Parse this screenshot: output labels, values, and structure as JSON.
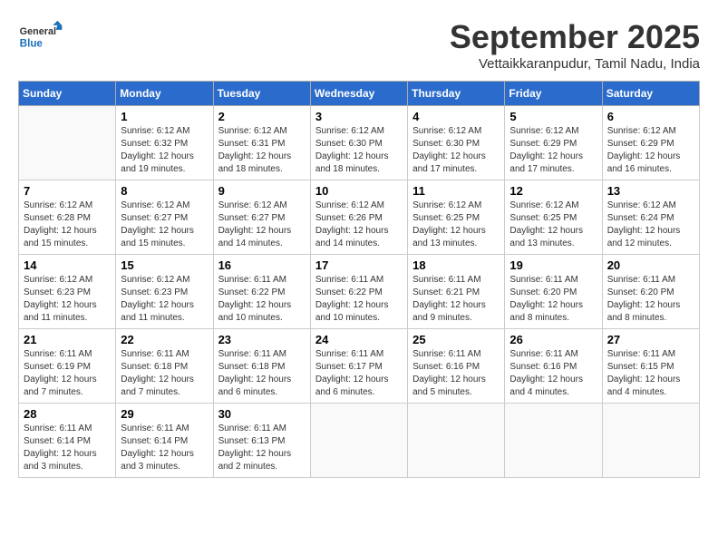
{
  "header": {
    "logo_general": "General",
    "logo_blue": "Blue",
    "month": "September 2025",
    "location": "Vettaikkaranpudur, Tamil Nadu, India"
  },
  "weekdays": [
    "Sunday",
    "Monday",
    "Tuesday",
    "Wednesday",
    "Thursday",
    "Friday",
    "Saturday"
  ],
  "weeks": [
    [
      {
        "day": "",
        "info": ""
      },
      {
        "day": "1",
        "info": "Sunrise: 6:12 AM\nSunset: 6:32 PM\nDaylight: 12 hours\nand 19 minutes."
      },
      {
        "day": "2",
        "info": "Sunrise: 6:12 AM\nSunset: 6:31 PM\nDaylight: 12 hours\nand 18 minutes."
      },
      {
        "day": "3",
        "info": "Sunrise: 6:12 AM\nSunset: 6:30 PM\nDaylight: 12 hours\nand 18 minutes."
      },
      {
        "day": "4",
        "info": "Sunrise: 6:12 AM\nSunset: 6:30 PM\nDaylight: 12 hours\nand 17 minutes."
      },
      {
        "day": "5",
        "info": "Sunrise: 6:12 AM\nSunset: 6:29 PM\nDaylight: 12 hours\nand 17 minutes."
      },
      {
        "day": "6",
        "info": "Sunrise: 6:12 AM\nSunset: 6:29 PM\nDaylight: 12 hours\nand 16 minutes."
      }
    ],
    [
      {
        "day": "7",
        "info": "Sunrise: 6:12 AM\nSunset: 6:28 PM\nDaylight: 12 hours\nand 15 minutes."
      },
      {
        "day": "8",
        "info": "Sunrise: 6:12 AM\nSunset: 6:27 PM\nDaylight: 12 hours\nand 15 minutes."
      },
      {
        "day": "9",
        "info": "Sunrise: 6:12 AM\nSunset: 6:27 PM\nDaylight: 12 hours\nand 14 minutes."
      },
      {
        "day": "10",
        "info": "Sunrise: 6:12 AM\nSunset: 6:26 PM\nDaylight: 12 hours\nand 14 minutes."
      },
      {
        "day": "11",
        "info": "Sunrise: 6:12 AM\nSunset: 6:25 PM\nDaylight: 12 hours\nand 13 minutes."
      },
      {
        "day": "12",
        "info": "Sunrise: 6:12 AM\nSunset: 6:25 PM\nDaylight: 12 hours\nand 13 minutes."
      },
      {
        "day": "13",
        "info": "Sunrise: 6:12 AM\nSunset: 6:24 PM\nDaylight: 12 hours\nand 12 minutes."
      }
    ],
    [
      {
        "day": "14",
        "info": "Sunrise: 6:12 AM\nSunset: 6:23 PM\nDaylight: 12 hours\nand 11 minutes."
      },
      {
        "day": "15",
        "info": "Sunrise: 6:12 AM\nSunset: 6:23 PM\nDaylight: 12 hours\nand 11 minutes."
      },
      {
        "day": "16",
        "info": "Sunrise: 6:11 AM\nSunset: 6:22 PM\nDaylight: 12 hours\nand 10 minutes."
      },
      {
        "day": "17",
        "info": "Sunrise: 6:11 AM\nSunset: 6:22 PM\nDaylight: 12 hours\nand 10 minutes."
      },
      {
        "day": "18",
        "info": "Sunrise: 6:11 AM\nSunset: 6:21 PM\nDaylight: 12 hours\nand 9 minutes."
      },
      {
        "day": "19",
        "info": "Sunrise: 6:11 AM\nSunset: 6:20 PM\nDaylight: 12 hours\nand 8 minutes."
      },
      {
        "day": "20",
        "info": "Sunrise: 6:11 AM\nSunset: 6:20 PM\nDaylight: 12 hours\nand 8 minutes."
      }
    ],
    [
      {
        "day": "21",
        "info": "Sunrise: 6:11 AM\nSunset: 6:19 PM\nDaylight: 12 hours\nand 7 minutes."
      },
      {
        "day": "22",
        "info": "Sunrise: 6:11 AM\nSunset: 6:18 PM\nDaylight: 12 hours\nand 7 minutes."
      },
      {
        "day": "23",
        "info": "Sunrise: 6:11 AM\nSunset: 6:18 PM\nDaylight: 12 hours\nand 6 minutes."
      },
      {
        "day": "24",
        "info": "Sunrise: 6:11 AM\nSunset: 6:17 PM\nDaylight: 12 hours\nand 6 minutes."
      },
      {
        "day": "25",
        "info": "Sunrise: 6:11 AM\nSunset: 6:16 PM\nDaylight: 12 hours\nand 5 minutes."
      },
      {
        "day": "26",
        "info": "Sunrise: 6:11 AM\nSunset: 6:16 PM\nDaylight: 12 hours\nand 4 minutes."
      },
      {
        "day": "27",
        "info": "Sunrise: 6:11 AM\nSunset: 6:15 PM\nDaylight: 12 hours\nand 4 minutes."
      }
    ],
    [
      {
        "day": "28",
        "info": "Sunrise: 6:11 AM\nSunset: 6:14 PM\nDaylight: 12 hours\nand 3 minutes."
      },
      {
        "day": "29",
        "info": "Sunrise: 6:11 AM\nSunset: 6:14 PM\nDaylight: 12 hours\nand 3 minutes."
      },
      {
        "day": "30",
        "info": "Sunrise: 6:11 AM\nSunset: 6:13 PM\nDaylight: 12 hours\nand 2 minutes."
      },
      {
        "day": "",
        "info": ""
      },
      {
        "day": "",
        "info": ""
      },
      {
        "day": "",
        "info": ""
      },
      {
        "day": "",
        "info": ""
      }
    ]
  ]
}
